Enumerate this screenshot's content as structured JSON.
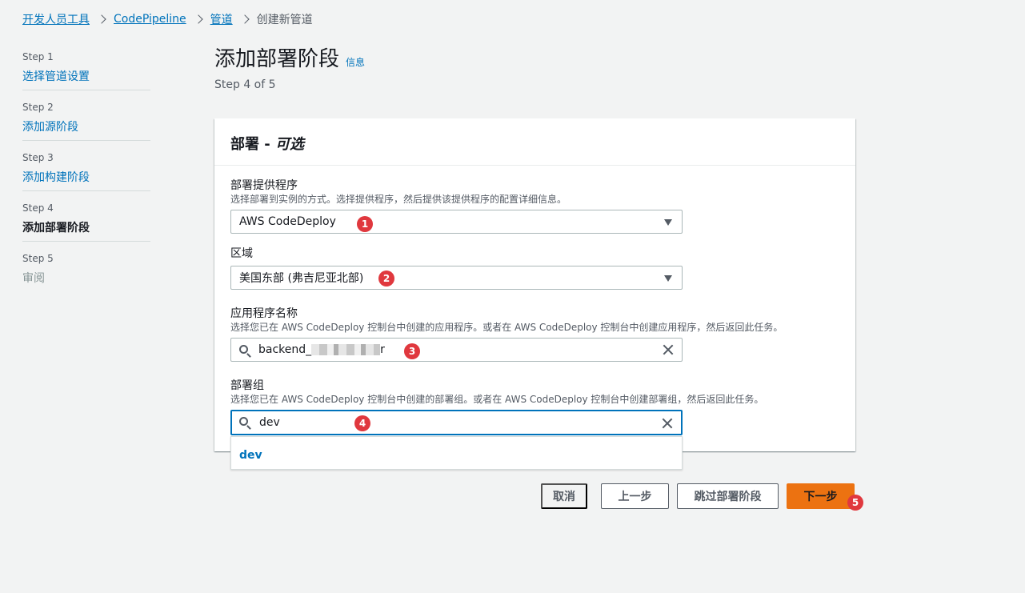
{
  "breadcrumb": {
    "items": [
      "开发人员工具",
      "CodePipeline",
      "管道"
    ],
    "current": "创建新管道"
  },
  "steps": [
    {
      "num": "Step 1",
      "label": "选择管道设置",
      "state": "link"
    },
    {
      "num": "Step 2",
      "label": "添加源阶段",
      "state": "link"
    },
    {
      "num": "Step 3",
      "label": "添加构建阶段",
      "state": "link"
    },
    {
      "num": "Step 4",
      "label": "添加部署阶段",
      "state": "active"
    },
    {
      "num": "Step 5",
      "label": "审阅",
      "state": "disabled"
    }
  ],
  "header": {
    "title": "添加部署阶段",
    "info": "信息",
    "step_indicator": "Step 4 of 5"
  },
  "panel": {
    "title_main": "部署 - ",
    "title_optional": "可选",
    "provider": {
      "label": "部署提供程序",
      "desc": "选择部署到实例的方式。选择提供程序，然后提供该提供程序的配置详细信息。",
      "value": "AWS CodeDeploy"
    },
    "region": {
      "label": "区域",
      "value": "美国东部 (弗吉尼亚北部)"
    },
    "application": {
      "label": "应用程序名称",
      "desc": "选择您已在 AWS CodeDeploy 控制台中创建的应用程序。或者在 AWS CodeDeploy 控制台中创建应用程序，然后返回此任务。",
      "value_prefix": "backend_",
      "value_suffix": "r"
    },
    "deployment_group": {
      "label": "部署组",
      "desc": "选择您已在 AWS CodeDeploy 控制台中创建的部署组。或者在 AWS CodeDeploy 控制台中创建部署组，然后返回此任务。",
      "value": "dev",
      "options": [
        "dev"
      ]
    }
  },
  "badges": [
    "1",
    "2",
    "3",
    "4",
    "5"
  ],
  "actions": {
    "cancel": "取消",
    "previous": "上一步",
    "skip": "跳过部署阶段",
    "next": "下一步"
  },
  "colors": {
    "link": "#0073bb",
    "primary": "#ec7211",
    "badge": "#e0383e"
  }
}
